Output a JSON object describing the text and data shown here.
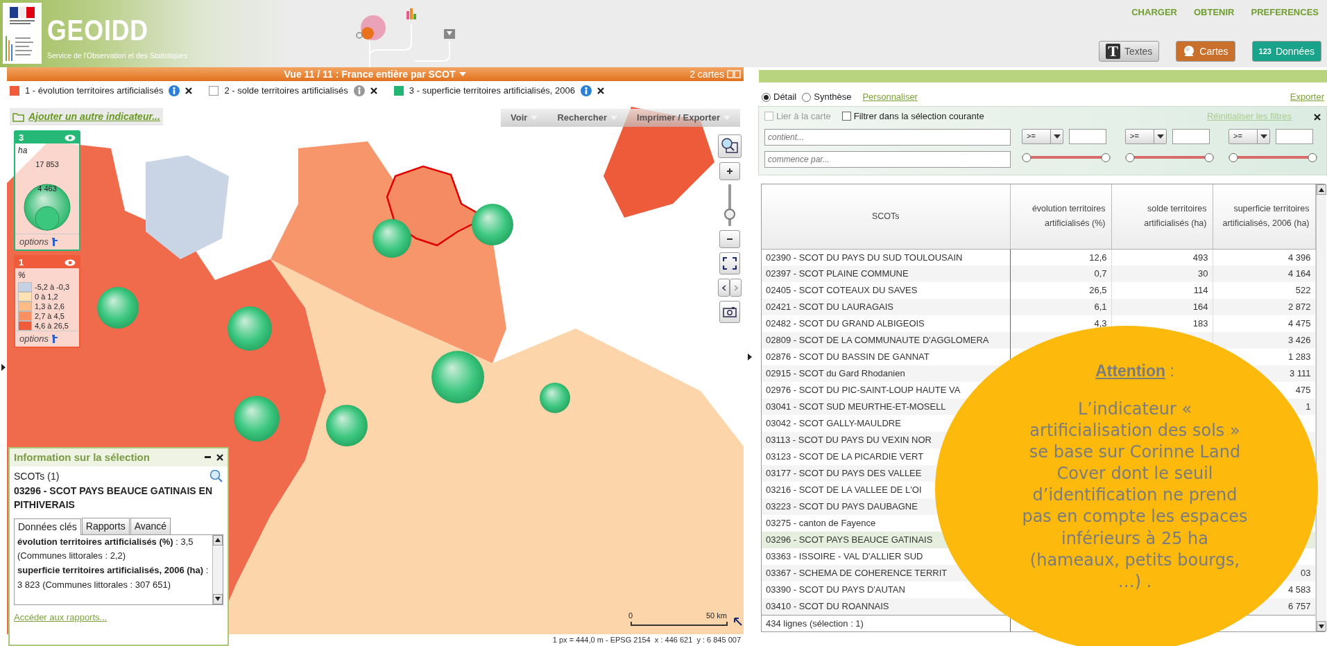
{
  "header": {
    "logo_title": "GEOIDD",
    "logo_subtitle": "Service de l'Observation et des Statistiques",
    "menu": [
      "CHARGER",
      "OBTENIR",
      "PREFERENCES"
    ],
    "view_buttons": [
      {
        "label": "Textes",
        "kind": "text",
        "icon_text": "T",
        "selected": false
      },
      {
        "label": "Cartes",
        "kind": "maps",
        "selected": true
      },
      {
        "label": "Données",
        "kind": "data",
        "icon_text": "123",
        "selected": true
      }
    ]
  },
  "map": {
    "title": "Vue 11 / 11 : France entière par SCOT",
    "map_count": "2 cartes",
    "indicators": [
      {
        "label": "1 - évolution territoires artificialisés",
        "color": "#ef5b3b",
        "shown": true
      },
      {
        "label": "2 - solde territoires artificialisés",
        "shown": false
      },
      {
        "label": "3 - superficie territoires artificialisés, 2006",
        "color": "#22b573",
        "shown": true
      }
    ],
    "add_indicator": "Ajouter un autre indicateur...",
    "toolbar": [
      "Voir",
      "Rechercher",
      "Imprimer / Exporter"
    ],
    "zoom_slider": {
      "level": 0.2
    },
    "legends": [
      {
        "kind": "bubbles",
        "number": "3",
        "color": "#26b877",
        "unit": "ha",
        "values": [
          "17 853",
          "4 463"
        ],
        "options": "options"
      },
      {
        "kind": "classes",
        "number": "1",
        "color": "#ef5b3b",
        "unit": "%",
        "options": "options",
        "classes": [
          {
            "label": "-5,2 à -0,3",
            "color": "#c5d2e6"
          },
          {
            "label": "0 à 1,2",
            "color": "#fde2b3"
          },
          {
            "label": "1,3 à 2,6",
            "color": "#fdbb88"
          },
          {
            "label": "2,7 à 4,5",
            "color": "#f8905f"
          },
          {
            "label": "4,6 à 26,5",
            "color": "#ee5c3c"
          }
        ]
      }
    ],
    "scale": {
      "start": "0",
      "end": "50 km"
    },
    "status": "1 px = 444,0 m - EPSG 2154  x : 446 621  y : 6 845 007"
  },
  "selection_panel": {
    "title": "Information sur la sélection",
    "count": "SCOTs (1)",
    "name": "03296 - SCOT PAYS BEAUCE GATINAIS EN PITHIVERAIS",
    "tabs": [
      {
        "label": "Données clés",
        "selected": true
      },
      {
        "label": "Rapports",
        "selected": false
      },
      {
        "label": "Avancé",
        "selected": false
      }
    ],
    "entries": [
      "**évolution territoires artificialisés (%)** : 3,5 (Communes littorales : 2,2)",
      "**superficie territoires artificialisés, 2006 (ha)** : 3 823 (Communes littorales : 307 651)"
    ],
    "link": "Accéder aux rapports..."
  },
  "data_panel": {
    "modes": [
      {
        "label": "Détail",
        "selected": true
      },
      {
        "label": "Synthèse",
        "selected": false
      }
    ],
    "customize": "Personnaliser",
    "export": "Exporter",
    "filters": {
      "options": [
        {
          "label": "Lier à la carte",
          "checked": false,
          "disabled": true
        },
        {
          "label": "Filtrer dans la sélection courante",
          "checked": false,
          "disabled": false
        }
      ],
      "reset": "Réinitialiser les filtres",
      "text_filters": [
        {
          "placeholder": "contient..."
        },
        {
          "placeholder": "commence par..."
        }
      ],
      "column_filters": [
        {
          "operator": ">=",
          "level": 1
        },
        {
          "operator": ">=",
          "level": 1
        },
        {
          "operator": ">=",
          "level": 1
        }
      ]
    },
    "table": {
      "columns": [
        "SCOTs",
        "évolution territoires artificialisés (%)",
        "solde territoires artificialisés (ha)",
        "superficie territoires artificialisés, 2006 (ha)"
      ],
      "rows": [
        {
          "scot": "02390 - SCOT DU PAYS DU SUD TOULOUSAIN",
          "evolution": "12,6",
          "solde": "493",
          "superficie": "4 396",
          "selected": false
        },
        {
          "scot": "02397 - SCOT PLAINE COMMUNE",
          "evolution": "0,7",
          "solde": "30",
          "superficie": "4 164",
          "selected": false
        },
        {
          "scot": "02405 - SCOT COTEAUX DU SAVES",
          "evolution": "26,5",
          "solde": "114",
          "superficie": "522",
          "selected": false
        },
        {
          "scot": "02421 - SCOT DU LAURAGAIS",
          "evolution": "6,1",
          "solde": "164",
          "superficie": "2 872",
          "selected": false
        },
        {
          "scot": "02482 - SCOT DU GRAND ALBIGEOIS",
          "evolution": "4,3",
          "solde": "183",
          "superficie": "4 475",
          "selected": false
        },
        {
          "scot": "02809 - SCOT DE LA COMMUNAUTE D'AGGLOMERA",
          "superficie": "3 426",
          "selected": false
        },
        {
          "scot": "02876 - SCOT DU BASSIN DE GANNAT",
          "superficie": "1 283",
          "selected": false
        },
        {
          "scot": "02915 - SCOT du Gard Rhodanien",
          "superficie": "3 111",
          "selected": false
        },
        {
          "scot": "02976 - SCOT DU PIC-SAINT-LOUP HAUTE VA",
          "superficie": "475",
          "selected": false
        },
        {
          "scot": "03041 - SCOT SUD MEURTHE-ET-MOSELL",
          "superficie": "1",
          "selected": false
        },
        {
          "scot": "03042 - SCOT GALLY-MAULDRE",
          "selected": false
        },
        {
          "scot": "03113 - SCOT DU PAYS DU VEXIN NOR",
          "selected": false
        },
        {
          "scot": "03123 - SCOT DE LA PICARDIE VERT",
          "selected": false
        },
        {
          "scot": "03177 - SCOT DU PAYS DES VALLEE",
          "selected": false
        },
        {
          "scot": "03216 - SCOT DE LA VALLEE DE L'OI",
          "selected": false
        },
        {
          "scot": "03223 - SCOT DU PAYS DAUBAGNE",
          "selected": false
        },
        {
          "scot": "03275 - canton de Fayence",
          "selected": false
        },
        {
          "scot": "03296 - SCOT PAYS BEAUCE GATINAIS",
          "selected": true
        },
        {
          "scot": "03363 - ISSOIRE - VAL D'ALLIER SUD",
          "selected": false
        },
        {
          "scot": "03367 - SCHEMA DE COHERENCE TERRIT",
          "superficie": "03",
          "selected": false
        },
        {
          "scot": "03390 - SCOT DU PAYS D'AUTAN",
          "superficie": "4 583",
          "selected": false
        },
        {
          "scot": "03410 - SCOT DU ROANNAIS",
          "superficie": "6 757",
          "selected": false
        }
      ],
      "footer": "434 lignes (sélection : 1)"
    }
  },
  "callout": {
    "title": "**Attention** :",
    "text": "L’indicateur « artificialisation des sols » se base sur Corinne Land Cover dont le seuil d’identification ne prend pas en compte les espaces inférieurs à 25 ha (hameaux, petits bourgs, …) ."
  }
}
